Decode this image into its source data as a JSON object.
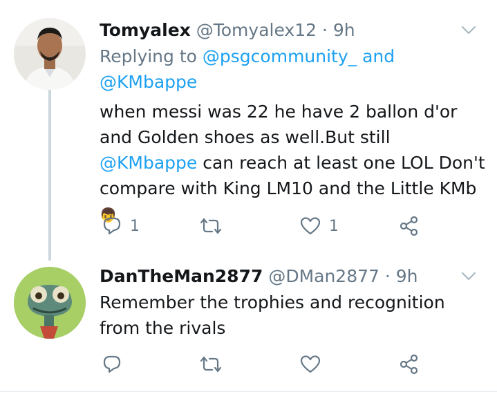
{
  "tweets": [
    {
      "name": "Tomyalex",
      "handle": "@Tomyalex12",
      "separator": "·",
      "time": "9h",
      "replying": {
        "prefix": "Replying to",
        "first": "@psgcommunity_",
        "conj": "and",
        "second": "@KMbappe"
      },
      "body": {
        "part1": "when messi was 22 he have 2 ballon d'or and Golden shoes as well.But still ",
        "mention": "@KMbappe",
        "part2": " can reach at least one LOL Don't compare with King LM10 and the Little KMb ",
        "emoji": "👦"
      },
      "actions": {
        "replies": "1",
        "retweets": "",
        "likes": "1"
      },
      "avatar_icon": "man-portrait"
    },
    {
      "name": "DanTheMan2877",
      "handle": "@DMan2877",
      "separator": "·",
      "time": "9h",
      "body": {
        "text": "Remember the trophies and recognition from the rivals"
      },
      "actions": {
        "replies": "",
        "retweets": "",
        "likes": ""
      },
      "avatar_icon": "chameleon-cartoon"
    }
  ],
  "colors": {
    "link": "#1da1f2",
    "muted": "#657786",
    "thread": "#ccd6dd"
  }
}
